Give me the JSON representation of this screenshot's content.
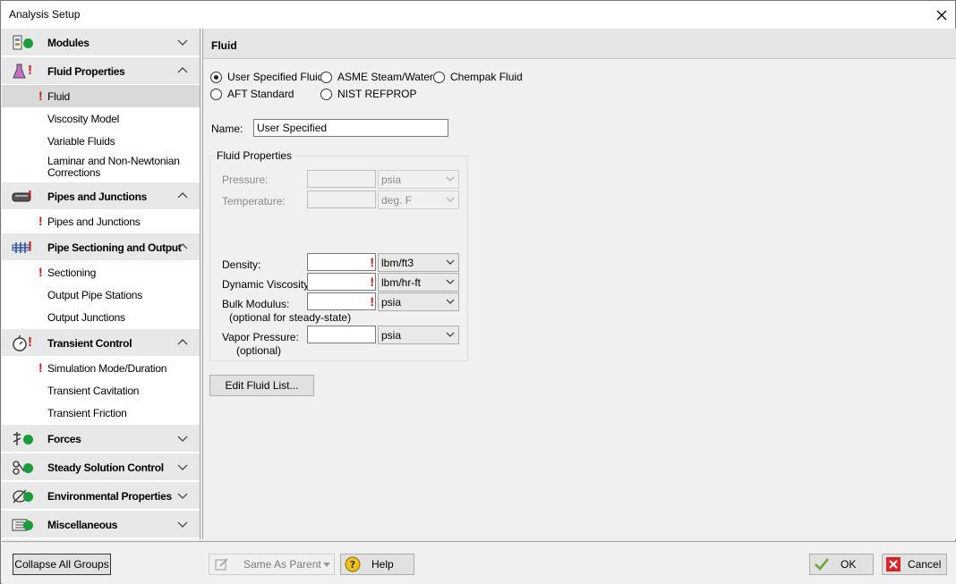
{
  "window": {
    "title": "Analysis Setup"
  },
  "sidebar": {
    "groups": [
      {
        "label": "Modules",
        "icon": "modules-icon",
        "items": []
      },
      {
        "label": "Fluid Properties",
        "icon": "flask-icon",
        "items": [
          "Fluid",
          "Viscosity Model",
          "Variable Fluids",
          "Laminar and Non-Newtonian Corrections"
        ]
      },
      {
        "label": "Pipes and Junctions",
        "icon": "pipe-icon",
        "items": [
          "Pipes and Junctions"
        ]
      },
      {
        "label": "Pipe Sectioning and Output",
        "icon": "sectioning-icon",
        "items": [
          "Sectioning",
          "Output Pipe Stations",
          "Output Junctions"
        ]
      },
      {
        "label": "Transient Control",
        "icon": "stopwatch-icon",
        "items": [
          "Simulation Mode/Duration",
          "Transient Cavitation",
          "Transient Friction"
        ]
      },
      {
        "label": "Forces",
        "icon": "forces-icon",
        "items": []
      },
      {
        "label": "Steady Solution Control",
        "icon": "solution-control-icon",
        "items": []
      },
      {
        "label": "Environmental Properties",
        "icon": "environment-icon",
        "items": []
      },
      {
        "label": "Miscellaneous",
        "icon": "misc-icon",
        "items": []
      }
    ],
    "laminar_line1": "Laminar and Non-Newtonian",
    "laminar_line2": "Corrections"
  },
  "main": {
    "header": "Fluid",
    "fluid_options": [
      "User Specified Fluid",
      "ASME Steam/Water",
      "Chempak Fluid",
      "AFT Standard",
      "NIST REFPROP"
    ],
    "selected_option": "User Specified Fluid",
    "name_label": "Name:",
    "name_value": "User Specified",
    "fluid_props": {
      "title": "Fluid Properties",
      "pressure_label": "Pressure:",
      "pressure_unit": "psia",
      "temperature_label": "Temperature:",
      "temperature_unit": "deg. F",
      "density_label": "Density:",
      "density_unit": "lbm/ft3",
      "viscosity_label": "Dynamic Viscosity:",
      "viscosity_unit": "lbm/hr-ft",
      "bulk_label": "Bulk Modulus:",
      "bulk_note": "(optional for steady-state)",
      "bulk_unit": "psia",
      "vapor_label": "Vapor Pressure:",
      "vapor_note": "(optional)",
      "vapor_unit": "psia"
    },
    "edit_button": "Edit Fluid List..."
  },
  "footer": {
    "collapse": "Collapse All Groups",
    "same_as_parent": "Same As Parent",
    "help": "Help",
    "ok": "OK",
    "cancel": "Cancel"
  },
  "colors": {
    "error": "#d21414",
    "ok_green": "#1a9c3a",
    "selected_bg": "#d9d9d9"
  }
}
